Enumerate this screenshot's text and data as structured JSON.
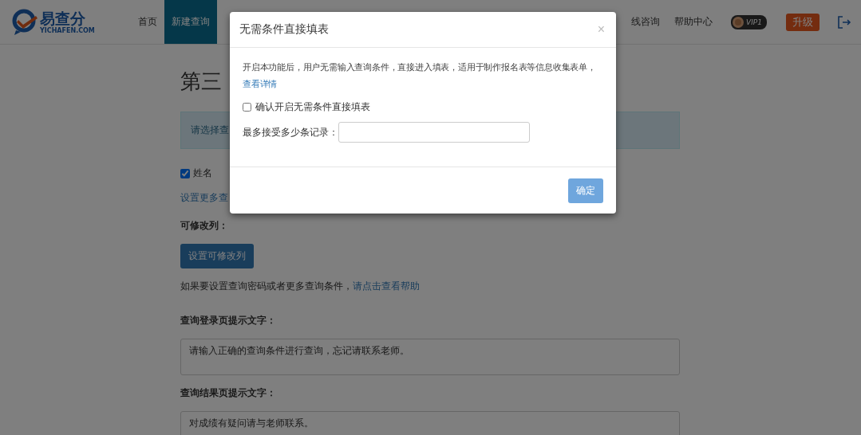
{
  "header": {
    "logo": {
      "name": "易查分",
      "domain": "YICHAFEN.COM"
    },
    "nav": [
      {
        "label": "首页",
        "selected": false
      },
      {
        "label": "新建查询",
        "selected": true
      }
    ],
    "nav_right": [
      {
        "label": "线咨询"
      },
      {
        "label": "帮助中心"
      }
    ],
    "vip_badge": "VIP1",
    "upgrade_button": "升级"
  },
  "page": {
    "title": "第三",
    "alert": "请选择查",
    "field_checkbox": {
      "label": "姓名",
      "checked": true
    },
    "more_link": "设置更多查",
    "editable_label": "可修改列：",
    "editable_button": "设置可修改列",
    "help_text": "如果要设置查询密码或者更多查询条件，",
    "help_link": "请点击查看帮助",
    "login_tip_label": "查询登录页提示文字：",
    "login_tip_value": "请输入正确的查询条件进行查询，忘记请联系老师。",
    "result_tip_label": "查询结果页提示文字：",
    "result_tip_value": "对成绩有疑问请与老师联系。"
  },
  "modal": {
    "title": "无需条件直接填表",
    "close": "×",
    "description": "开启本功能后，用户无需输入查询条件，直接进入填表，适用于制作报名表等信息收集表单，",
    "details_link": "查看详情",
    "confirm_checkbox": {
      "label": "确认开启无需条件直接填表",
      "checked": false
    },
    "max_records_label": "最多接受多少条记录：",
    "ok_button": "确定"
  }
}
